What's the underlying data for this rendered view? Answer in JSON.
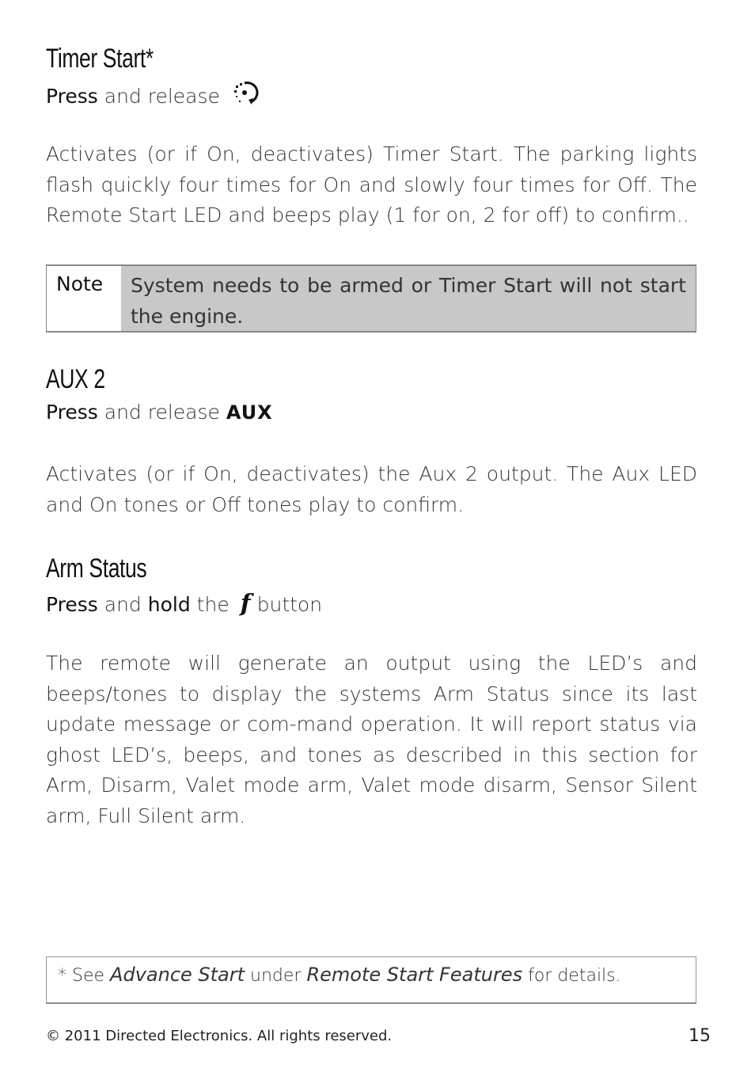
{
  "sections": [
    {
      "title": "Timer Start*",
      "instruction": {
        "press": "Press",
        "rest": "and release"
      },
      "icon": "timer-start-icon",
      "body": "Activates (or if On, deactivates) Timer Start. The parking lights flash quickly four times for On and slowly four times for Off. The Remote Start LED and beeps play (1 for on, 2 for off) to confirm.."
    },
    {
      "title": "AUX 2",
      "instruction": {
        "press": "Press",
        "rest": "and release",
        "button": "AUX"
      },
      "body": "Activates (or if On, deactivates) the Aux 2 output. The Aux LED and On tones or Off tones play to confirm."
    },
    {
      "title": "Arm Status",
      "instruction": {
        "press": "Press",
        "and": "and",
        "hold": "hold",
        "the": "the",
        "button_glyph": "f",
        "after": "button"
      },
      "body": "The remote will generate an output using the LED’s and beeps/tones to display the systems Arm Status since its last update message or com-mand operation. It will report status via ghost LED’s, beeps, and tones as described in this section for Arm, Disarm, Valet mode arm, Valet mode disarm, Sensor Silent arm, Full Silent arm."
    }
  ],
  "note": {
    "label": "Note",
    "text": "System needs to be armed or Timer Start will not start the engine."
  },
  "footnote": {
    "star": "*",
    "see": "See",
    "ref1": "Advance Start",
    "under": "under",
    "ref2": "Remote Start Features",
    "tail": "for details."
  },
  "footer": {
    "copyright": "© 2011 Directed Electronics. All rights reserved.",
    "page_number": "15"
  }
}
